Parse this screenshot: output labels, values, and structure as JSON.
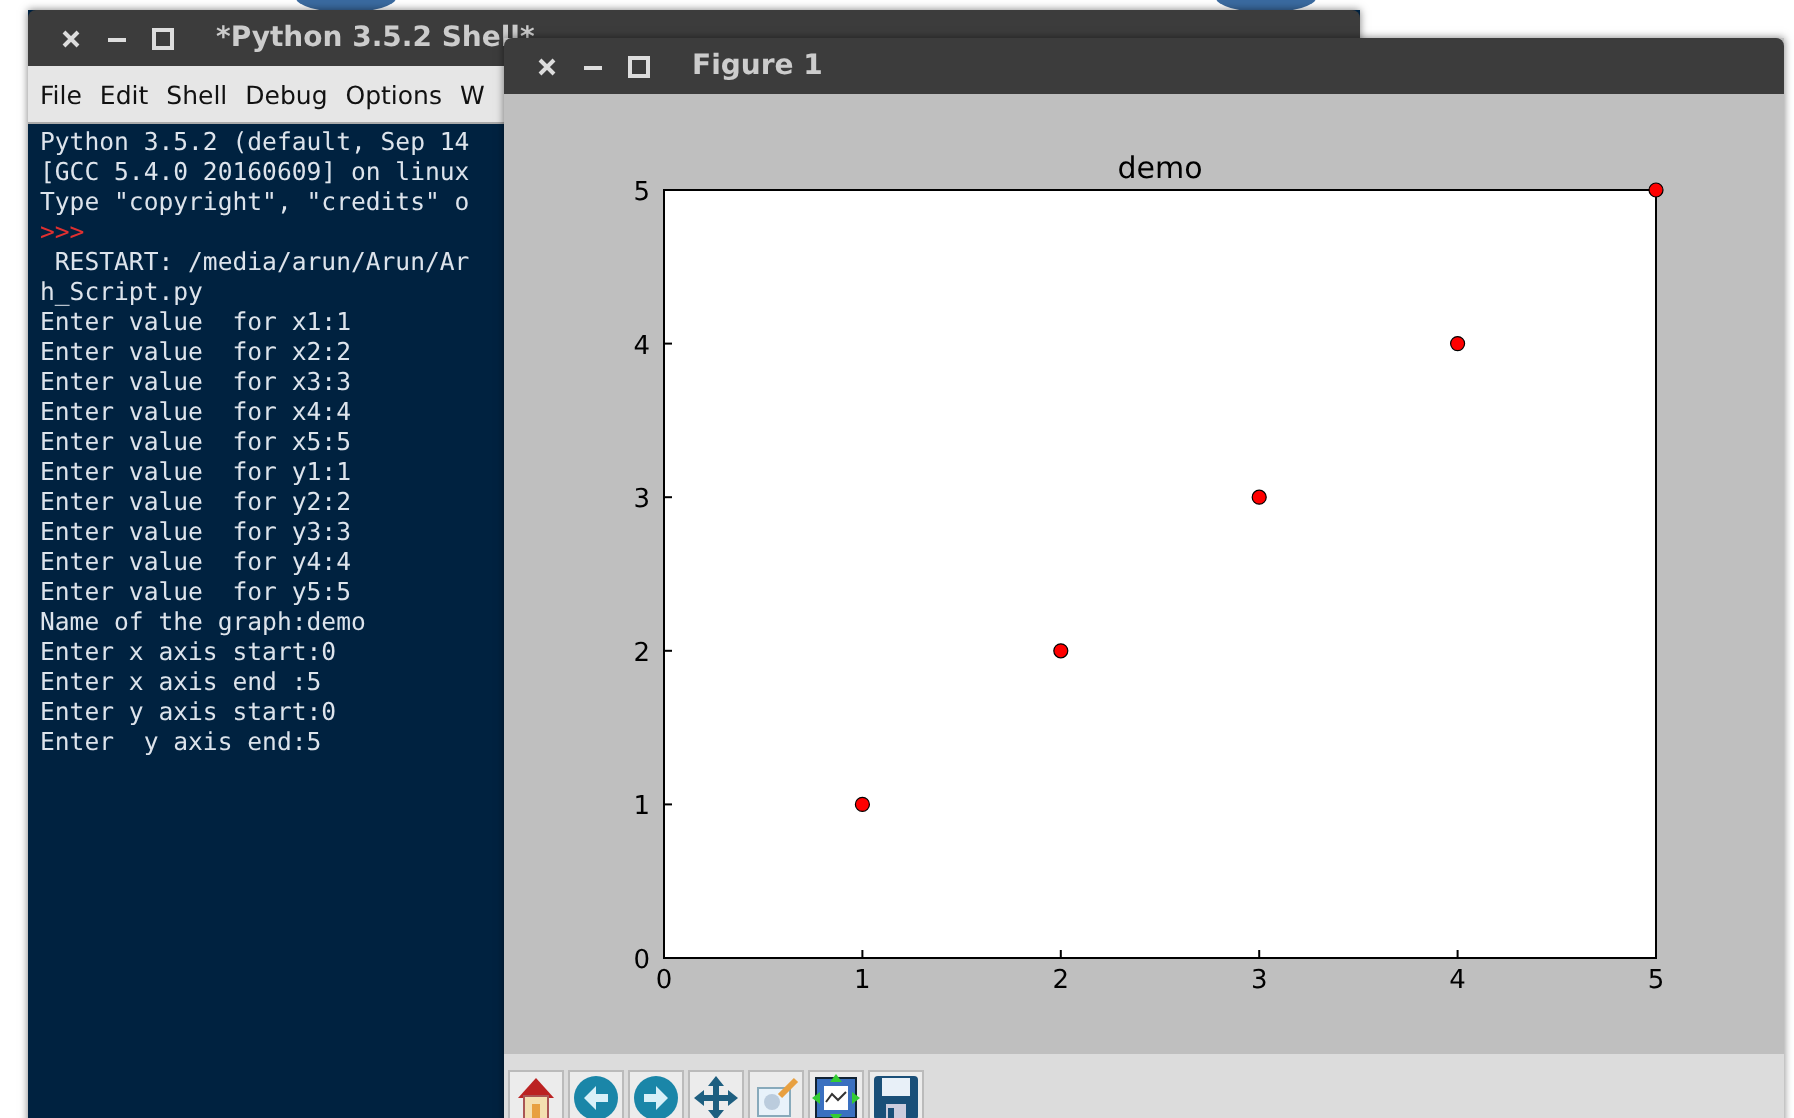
{
  "shell_window": {
    "title": "*Python 3.5.2 Shell*",
    "menu": [
      "File",
      "Edit",
      "Shell",
      "Debug",
      "Options",
      "W"
    ],
    "lines": [
      {
        "kind": "output",
        "text": "Python 3.5.2 (default, Sep 14"
      },
      {
        "kind": "output",
        "text": "[GCC 5.4.0 20160609] on linux"
      },
      {
        "kind": "output",
        "text": "Type \"copyright\", \"credits\" o"
      },
      {
        "kind": "prompt",
        "text": ">>>"
      },
      {
        "kind": "output",
        "text": " RESTART: /media/arun/Arun/Ar"
      },
      {
        "kind": "output",
        "text": "h_Script.py"
      },
      {
        "kind": "output",
        "text": "Enter value  for x1:1"
      },
      {
        "kind": "output",
        "text": "Enter value  for x2:2"
      },
      {
        "kind": "output",
        "text": "Enter value  for x3:3"
      },
      {
        "kind": "output",
        "text": "Enter value  for x4:4"
      },
      {
        "kind": "output",
        "text": "Enter value  for x5:5"
      },
      {
        "kind": "output",
        "text": "Enter value  for y1:1"
      },
      {
        "kind": "output",
        "text": "Enter value  for y2:2"
      },
      {
        "kind": "output",
        "text": "Enter value  for y3:3"
      },
      {
        "kind": "output",
        "text": "Enter value  for y4:4"
      },
      {
        "kind": "output",
        "text": "Enter value  for y5:5"
      },
      {
        "kind": "output",
        "text": "Name of the graph:demo"
      },
      {
        "kind": "output",
        "text": "Enter x axis start:0"
      },
      {
        "kind": "output",
        "text": "Enter x axis end :5"
      },
      {
        "kind": "output",
        "text": "Enter y axis start:0"
      },
      {
        "kind": "output",
        "text": "Enter  y axis end:5"
      }
    ]
  },
  "figure_window": {
    "title": "Figure 1",
    "chart_data": {
      "type": "scatter",
      "title": "demo",
      "x": [
        1,
        2,
        3,
        4,
        5
      ],
      "series": [
        {
          "color": "#ff0000",
          "values": [
            1,
            2,
            3,
            4,
            5
          ]
        }
      ],
      "xlim": [
        0,
        5
      ],
      "ylim": [
        0,
        5
      ],
      "xticks": [
        0,
        1,
        2,
        3,
        4,
        5
      ],
      "yticks": [
        0,
        1,
        2,
        3,
        4,
        5
      ]
    },
    "toolbar": [
      {
        "kind": "home"
      },
      {
        "kind": "back"
      },
      {
        "kind": "forward"
      },
      {
        "kind": "pan"
      },
      {
        "kind": "edit"
      },
      {
        "kind": "subplots"
      },
      {
        "kind": "save"
      }
    ]
  }
}
